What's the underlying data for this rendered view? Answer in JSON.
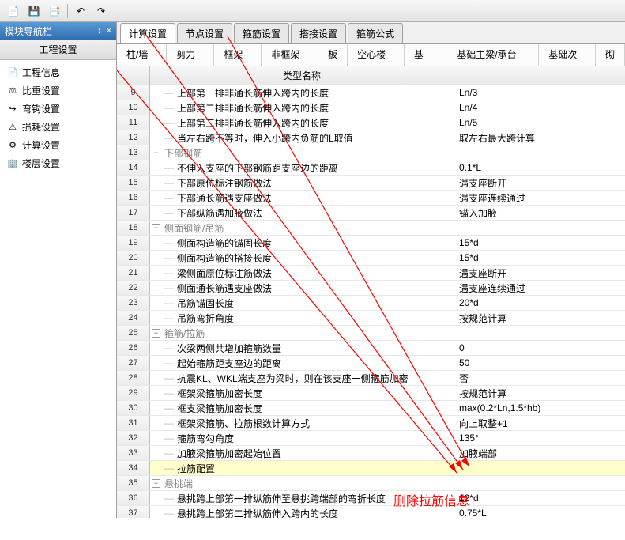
{
  "toolbar": {
    "icons": [
      "new",
      "save",
      "print",
      "undo",
      "redo"
    ]
  },
  "sidebar": {
    "title": "模块导航栏",
    "pin": "↕",
    "close": "×",
    "section": "工程设置",
    "items": [
      {
        "icon": "📄",
        "label": "工程信息"
      },
      {
        "icon": "⚖",
        "label": "比重设置"
      },
      {
        "icon": "↪",
        "label": "弯钩设置"
      },
      {
        "icon": "⚠",
        "label": "损耗设置"
      },
      {
        "icon": "⚙",
        "label": "计算设置"
      },
      {
        "icon": "🏢",
        "label": "楼层设置"
      }
    ]
  },
  "tabs1": [
    {
      "label": "计算设置",
      "active": true
    },
    {
      "label": "节点设置"
    },
    {
      "label": "箍筋设置"
    },
    {
      "label": "搭接设置"
    },
    {
      "label": "箍筋公式"
    }
  ],
  "tabs2": [
    {
      "label": "柱/墙柱"
    },
    {
      "label": "剪力墙"
    },
    {
      "label": "框架梁"
    },
    {
      "label": "非框架梁"
    },
    {
      "label": "板"
    },
    {
      "label": "空心楼盖"
    },
    {
      "label": "基础"
    },
    {
      "label": "基础主梁/承台梁"
    },
    {
      "label": "基础次梁"
    },
    {
      "label": "砌"
    }
  ],
  "grid": {
    "header_name": "类型名称",
    "rows": [
      {
        "n": 9,
        "name": "上部第一排非通长筋伸入跨内的长度",
        "val": "Ln/3"
      },
      {
        "n": 10,
        "name": "上部第二排非通长筋伸入跨内的长度",
        "val": "Ln/4"
      },
      {
        "n": 11,
        "name": "上部第三排非通长筋伸入跨内的长度",
        "val": "Ln/5"
      },
      {
        "n": 12,
        "name": "当左右跨不等时，伸入小跨内负筋的L取值",
        "val": "取左右最大跨计算"
      },
      {
        "n": 13,
        "name": "下部钢筋",
        "val": "",
        "group": true
      },
      {
        "n": 14,
        "name": "不伸入支座的下部钢筋距支座边的距离",
        "val": "0.1*L"
      },
      {
        "n": 15,
        "name": "下部原位标注钢筋做法",
        "val": "遇支座断开"
      },
      {
        "n": 16,
        "name": "下部通长筋遇支座做法",
        "val": "遇支座连续通过"
      },
      {
        "n": 17,
        "name": "下部纵筋遇加腋做法",
        "val": "锚入加腋"
      },
      {
        "n": 18,
        "name": "侧面钢筋/吊筋",
        "val": "",
        "group": true
      },
      {
        "n": 19,
        "name": "侧面构造筋的锚固长度",
        "val": "15*d"
      },
      {
        "n": 20,
        "name": "侧面构造筋的搭接长度",
        "val": "15*d"
      },
      {
        "n": 21,
        "name": "梁侧面原位标注筋做法",
        "val": "遇支座断开"
      },
      {
        "n": 22,
        "name": "侧面通长筋遇支座做法",
        "val": "遇支座连续通过"
      },
      {
        "n": 23,
        "name": "吊筋锚固长度",
        "val": "20*d"
      },
      {
        "n": 24,
        "name": "吊筋弯折角度",
        "val": "按规范计算"
      },
      {
        "n": 25,
        "name": "箍筋/拉筋",
        "val": "",
        "group": true
      },
      {
        "n": 26,
        "name": "次梁两侧共增加箍筋数量",
        "val": "0"
      },
      {
        "n": 27,
        "name": "起始箍筋距支座边的距离",
        "val": "50"
      },
      {
        "n": 28,
        "name": "抗震KL、WKL端支座为梁时，则在该支座一侧箍筋加密",
        "val": "否"
      },
      {
        "n": 29,
        "name": "框架梁箍筋加密长度",
        "val": "按规范计算"
      },
      {
        "n": 30,
        "name": "框支梁箍筋加密长度",
        "val": "max(0.2*Ln,1.5*hb)"
      },
      {
        "n": 31,
        "name": "框架梁箍筋、拉筋根数计算方式",
        "val": "向上取整+1"
      },
      {
        "n": 32,
        "name": "箍筋弯勾角度",
        "val": "135°"
      },
      {
        "n": 33,
        "name": "加腋梁箍筋加密起始位置",
        "val": "加腋端部"
      },
      {
        "n": 34,
        "name": "拉筋配置",
        "val": "",
        "highlight": true
      },
      {
        "n": 35,
        "name": "悬挑端",
        "val": "",
        "group": true
      },
      {
        "n": 36,
        "name": "悬挑跨上部第一排纵筋伸至悬挑跨端部的弯折长度",
        "val": "12*d"
      },
      {
        "n": 37,
        "name": "悬挑跨上部第二排纵筋伸入跨内的长度",
        "val": "0.75*L"
      }
    ]
  },
  "annotation": "删除拉筋信息"
}
